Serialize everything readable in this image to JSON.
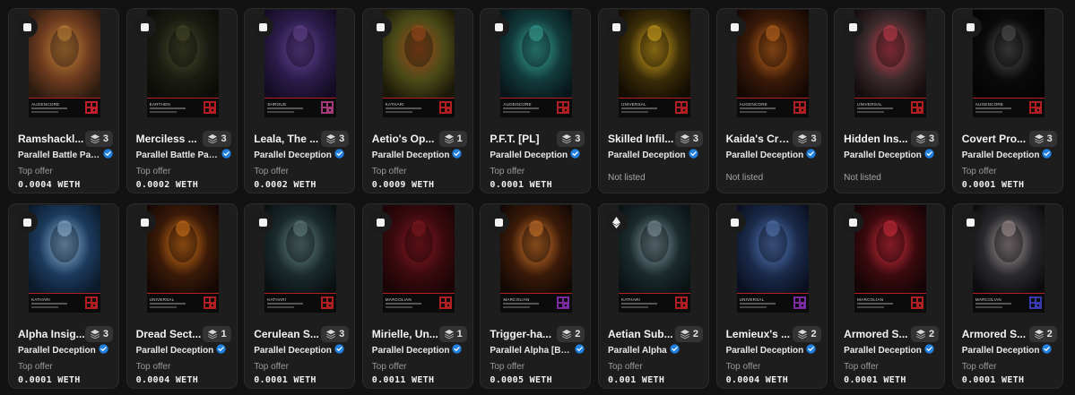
{
  "cards": [
    {
      "name": "Ramshackl...",
      "count": "3",
      "collection": "Parallel Battle Pas...",
      "offer_label": "Top offer",
      "price": "0.0004 WETH",
      "band": "AUGENCORE",
      "colors": [
        "#6b3a1e",
        "#c8873a",
        "#2a1a10"
      ],
      "accent": "#c01e2a"
    },
    {
      "name": "Merciless ...",
      "count": "3",
      "collection": "Parallel Battle Pas...",
      "offer_label": "Top offer",
      "price": "0.0002 WETH",
      "band": "EARTHEN",
      "colors": [
        "#1a1c12",
        "#4a4d2a",
        "#0c0c08"
      ],
      "accent": "#b31b22"
    },
    {
      "name": "Leala, The ...",
      "count": "3",
      "collection": "Parallel Deception",
      "offer_label": "Top offer",
      "price": "0.0002 WETH",
      "band": "SHROUD",
      "colors": [
        "#2a1c4a",
        "#6b4a9a",
        "#140c22"
      ],
      "accent": "#a23a7a"
    },
    {
      "name": "Aetio's Op...",
      "count": "1",
      "collection": "Parallel Deception",
      "offer_label": "Top offer",
      "price": "0.0009 WETH",
      "band": "KATHARI",
      "colors": [
        "#4a4a18",
        "#a8491c",
        "#1a1808"
      ],
      "accent": "#b01e22"
    },
    {
      "name": "P.F.T. [PL]",
      "count": "3",
      "collection": "Parallel Deception",
      "offer_label": "Top offer",
      "price": "0.0001 WETH",
      "band": "AUGENCORE",
      "colors": [
        "#123a3a",
        "#3bb0a0",
        "#08161a"
      ],
      "accent": "#b01e22"
    },
    {
      "name": "Skilled Infil...",
      "count": "3",
      "collection": "Parallel Deception",
      "listing": "Not listed",
      "band": "UNIVERSAL",
      "colors": [
        "#3a2c08",
        "#e0b020",
        "#120c02"
      ],
      "accent": "#b01e22"
    },
    {
      "name": "Kaida's Cre...",
      "count": "3",
      "collection": "Parallel Deception",
      "listing": "Not listed",
      "band": "AUGENCORE",
      "colors": [
        "#3a1a08",
        "#d07020",
        "#140804"
      ],
      "accent": "#b01e22"
    },
    {
      "name": "Hidden Ins...",
      "count": "3",
      "collection": "Parallel Deception",
      "listing": "Not listed",
      "band": "UNIVERSAL",
      "colors": [
        "#3a2a2c",
        "#d04050",
        "#140c0e"
      ],
      "accent": "#b01e22"
    },
    {
      "name": "Covert Pro...",
      "count": "3",
      "collection": "Parallel Deception",
      "offer_label": "Top offer",
      "price": "0.0001 WETH",
      "band": "AUGENCORE",
      "colors": [
        "#0a0a0a",
        "#5a5a5a",
        "#040404"
      ],
      "accent": "#b01e22"
    },
    {
      "name": "Alpha Insig...",
      "count": "3",
      "collection": "Parallel Deception",
      "offer_label": "Top offer",
      "price": "0.0001 WETH",
      "band": "KATHARI",
      "colors": [
        "#1c3a5c",
        "#9ac0e0",
        "#0a1a2a"
      ],
      "accent": "#b01e22"
    },
    {
      "name": "Dread Sect...",
      "count": "1",
      "collection": "Parallel Deception",
      "offer_label": "Top offer",
      "price": "0.0004 WETH",
      "band": "UNIVERSAL",
      "colors": [
        "#3a1a08",
        "#e07a1a",
        "#140804"
      ],
      "accent": "#b01e22"
    },
    {
      "name": "Cerulean S...",
      "count": "3",
      "collection": "Parallel Deception",
      "offer_label": "Top offer",
      "price": "0.0001 WETH",
      "band": "KATHARI",
      "colors": [
        "#1a2a2c",
        "#6a8a8a",
        "#0a1012"
      ],
      "accent": "#b01e22"
    },
    {
      "name": "Mirielle, Un...",
      "count": "1",
      "collection": "Parallel Deception",
      "offer_label": "Top offer",
      "price": "0.0011 WETH",
      "band": "MARCOLIAN",
      "colors": [
        "#3a0a0e",
        "#8a1a22",
        "#1a0406"
      ],
      "accent": "#b01e22"
    },
    {
      "name": "Trigger-ha...",
      "count": "2",
      "collection": "Parallel Alpha [Base]",
      "offer_label": "Top offer",
      "price": "0.0005 WETH",
      "band": "MARCOLIAN",
      "colors": [
        "#3a1a08",
        "#e08030",
        "#120804"
      ],
      "accent": "#7a2aa0"
    },
    {
      "name": "Aetian Sub...",
      "count": "2",
      "collection": "Parallel Alpha",
      "offer_label": "Top offer",
      "price": "0.001 WETH",
      "band": "KATHARI",
      "colors": [
        "#1a2a2c",
        "#8aa0a8",
        "#0a1214"
      ],
      "accent": "#b01e22",
      "eth": true
    },
    {
      "name": "Lemieux's ...",
      "count": "2",
      "collection": "Parallel Deception",
      "offer_label": "Top offer",
      "price": "0.0004 WETH",
      "band": "UNIVERSAL",
      "colors": [
        "#1a2a4a",
        "#5a80c0",
        "#0a1020"
      ],
      "accent": "#7a2aa0"
    },
    {
      "name": "Armored S...",
      "count": "2",
      "collection": "Parallel Deception",
      "offer_label": "Top offer",
      "price": "0.0001 WETH",
      "band": "MARCOLIAN",
      "colors": [
        "#3a0a0e",
        "#e03040",
        "#140406"
      ],
      "accent": "#b01e22"
    },
    {
      "name": "Armored S...",
      "count": "2",
      "collection": "Parallel Deception",
      "offer_label": "Top offer",
      "price": "0.0001 WETH",
      "band": "MARCOLIAN",
      "colors": [
        "#2a2a2e",
        "#b0a0a0",
        "#0c0c0e"
      ],
      "accent": "#3a3ab0"
    }
  ]
}
